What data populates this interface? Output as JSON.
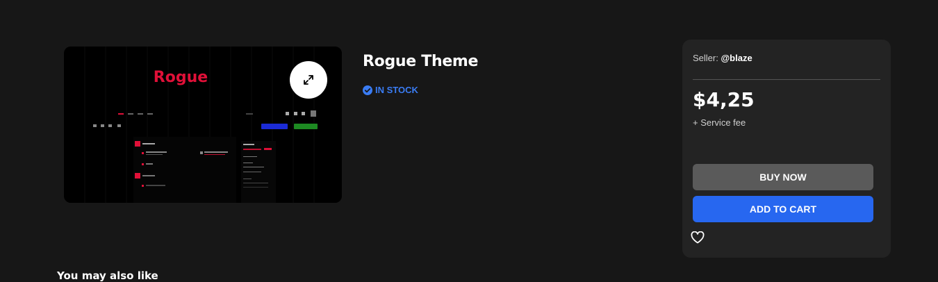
{
  "product": {
    "title": "Rogue Theme",
    "stock_status": "IN STOCK",
    "preview_brand": "Rogue"
  },
  "purchase": {
    "seller_label": "Seller:",
    "seller_name": "@blaze",
    "price": "$4,25",
    "fee_note": "+ Service fee",
    "buy_now_label": "BUY NOW",
    "add_to_cart_label": "ADD TO CART"
  },
  "recommendations": {
    "heading": "You may also like"
  },
  "icons": {
    "expand": "expand-icon",
    "stock": "check-circle-icon",
    "wishlist": "heart-icon"
  },
  "colors": {
    "background": "#171717",
    "card": "#232323",
    "accent": "#2767f0",
    "stock": "#3a7cf3",
    "brand": "#e01038"
  }
}
